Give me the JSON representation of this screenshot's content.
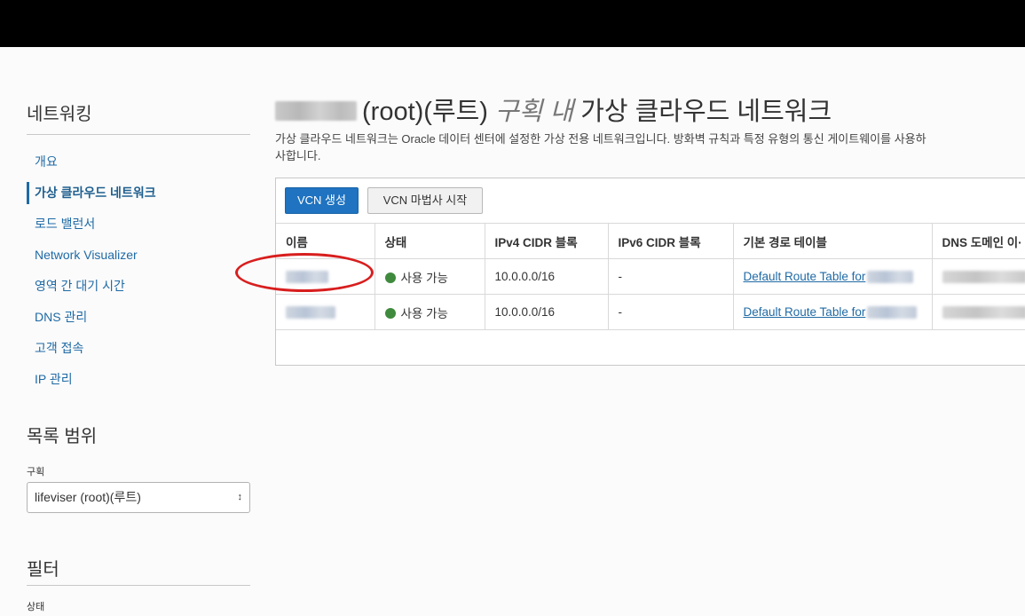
{
  "sidebar": {
    "title": "네트워킹",
    "items": [
      {
        "label": "개요"
      },
      {
        "label": "가상 클라우드 네트워크"
      },
      {
        "label": "로드 밸런서"
      },
      {
        "label": "Network Visualizer"
      },
      {
        "label": "영역 간 대기 시간"
      },
      {
        "label": "DNS 관리"
      },
      {
        "label": "고객 접속"
      },
      {
        "label": "IP 관리"
      }
    ],
    "scope": {
      "title": "목록 범위",
      "compartment_label": "구획",
      "compartment_value": "lifeviser (root)(루트)"
    },
    "filter": {
      "title": "필터",
      "state_label": "상태"
    }
  },
  "main": {
    "title_suffix": "(root)(루트)",
    "title_italic": "구획 내",
    "title_rest": "가상 클라우드 네트워크",
    "description": "가상 클라우드 네트워크는 Oracle 데이터 센터에 설정한 가상 전용 네트워크입니다. 방화벽 규칙과 특정 유형의 통신 게이트웨이를 사용하",
    "description_line2": "사합니다.",
    "buttons": {
      "create": "VCN 생성",
      "wizard": "VCN 마법사 시작"
    },
    "table": {
      "columns": [
        "이름",
        "상태",
        "IPv4 CIDR 블록",
        "IPv6 CIDR 블록",
        "기본 경로 테이블",
        "DNS 도메인 이·"
      ],
      "rows": [
        {
          "status": "사용 가능",
          "ipv4": "10.0.0.0/16",
          "ipv6": "-",
          "route_table": "Default Route Table for"
        },
        {
          "status": "사용 가능",
          "ipv4": "10.0.0.0/16",
          "ipv6": "-",
          "route_table": "Default Route Table for"
        }
      ]
    }
  },
  "colors": {
    "primary_button": "#1f73c0",
    "link": "#1f6aa5",
    "status_available": "#3f8a3d",
    "annotation": "#d81e1e"
  }
}
